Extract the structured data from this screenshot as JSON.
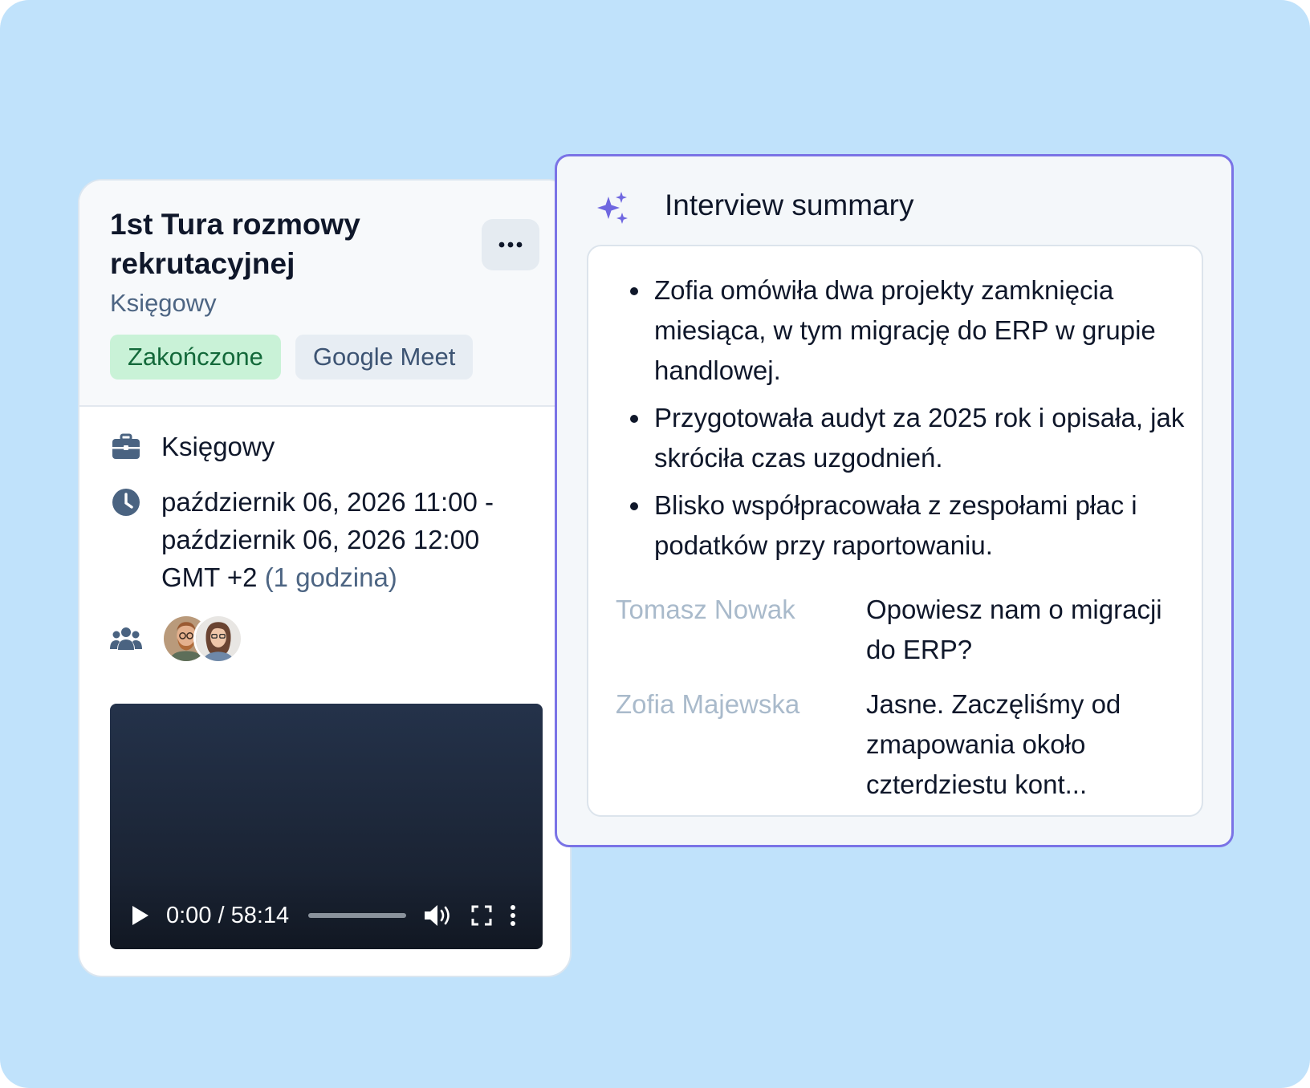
{
  "event": {
    "title": "1st Tura rozmowy rekrutacyjnej",
    "subtitle": "Księgowy",
    "more_label": "...",
    "status_tag": "Zakończone",
    "platform_tag": "Google Meet",
    "role": "Księgowy",
    "time_range": "październik 06, 2026 11:00 - październik 06, 2026 12:00 GMT +2",
    "duration": "(1 godzina)",
    "participants": [
      {
        "name": "participant-1"
      },
      {
        "name": "participant-2"
      }
    ],
    "video": {
      "time": "0:00 / 58:14",
      "progress": 0
    }
  },
  "summary": {
    "title": "Interview summary",
    "bullets": [
      "Zofia omówiła dwa projekty zamknięcia miesiąca, w tym migrację do ERP w grupie handlowej.",
      "Przygotowała audyt za 2025 rok i opisała, jak skróciła czas uzgodnień.",
      "Blisko współpracowała z zespołami płac i podatków przy raportowaniu."
    ],
    "transcript": [
      {
        "speaker": "Tomasz Nowak",
        "text": "Opowiesz nam o migracji do ERP?"
      },
      {
        "speaker": "Zofia Majewska",
        "text": "Jasne. Zaczęliśmy od zmapowania około czterdziestu kont..."
      }
    ]
  },
  "colors": {
    "background": "#c0e2fb",
    "accent": "#7a73e6",
    "status_bg": "#c9f2d7",
    "status_text": "#13693a"
  },
  "icons": [
    "more-icon",
    "briefcase-icon",
    "clock-icon",
    "users-icon",
    "sparkle-icon",
    "play-icon",
    "volume-icon",
    "fullscreen-icon",
    "kebab-icon"
  ]
}
